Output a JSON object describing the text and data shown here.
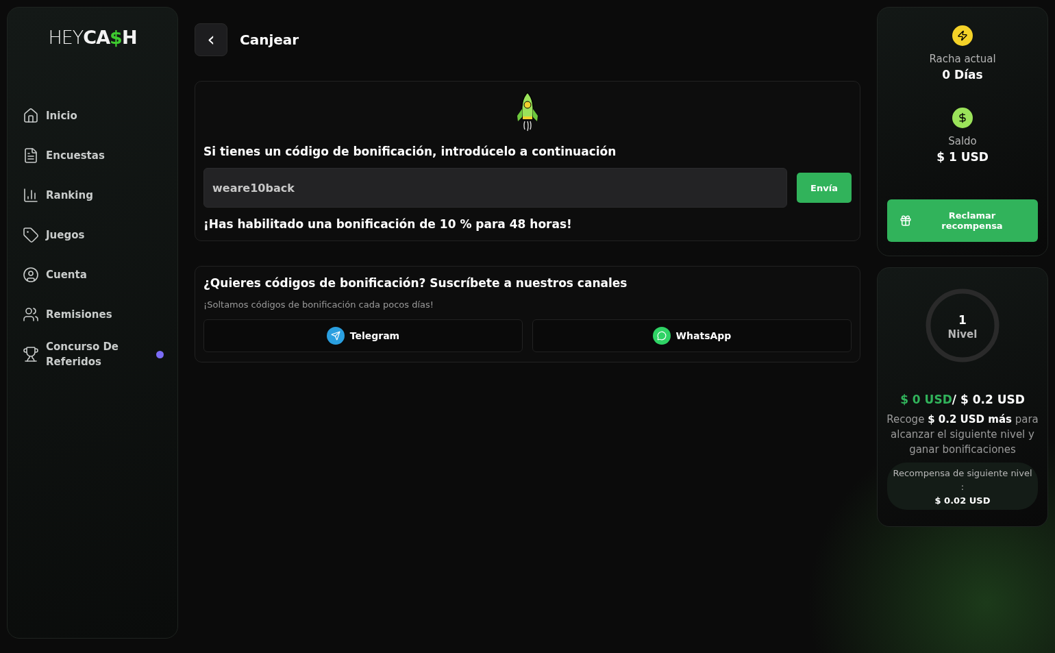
{
  "logo": [
    {
      "kind": "light",
      "text": "HEY"
    },
    {
      "kind": "bold",
      "text": "CA"
    },
    {
      "kind": "accent",
      "text": "$"
    },
    {
      "kind": "bold",
      "text": "H"
    }
  ],
  "nav": [
    {
      "label": "Inicio",
      "selected": false
    },
    {
      "label": "Encuestas",
      "selected": false
    },
    {
      "label": "Ranking",
      "selected": false
    },
    {
      "label": "Juegos",
      "selected": false
    },
    {
      "label": "Cuenta",
      "selected": false
    },
    {
      "label": "Remisiones",
      "selected": false
    },
    {
      "label": "Concurso De Referidos",
      "selected": false,
      "color": "#7b6cf6"
    }
  ],
  "header": {
    "back": "‹",
    "title": "Canjear"
  },
  "redeem": {
    "prompt": "Si tienes un código de bonificación, introdúcelo a continuación",
    "code_field": {
      "value": "weare10back"
    },
    "submit": "Envía",
    "message": "¡Has habilitado una bonificación de 10 % para 48 horas!"
  },
  "channels": {
    "title": "¿Quieres códigos de bonificación? Suscríbete a nuestros canales",
    "subtitle": "¡Soltamos códigos de bonificación cada pocos días!",
    "buttons": [
      {
        "kind": "telegram",
        "label": "Telegram"
      },
      {
        "kind": "whatsapp",
        "label": "WhatsApp"
      }
    ]
  },
  "stats": {
    "streak": {
      "label": "Racha actual",
      "value": "0 Días"
    },
    "balance": {
      "label": "Saldo",
      "value": "$ 1 USD"
    },
    "claim": "Reclamar recompensa"
  },
  "level": {
    "number": "1",
    "label": "Nivel",
    "current": "$ 0 USD",
    "target": "/ $ 0.2 USD",
    "hint": "Recoge **$ 0.2 USD más** para alcanzar el siguiente nivel y ganar bonificaciones",
    "reward_label": "Recompensa de siguiente nivel :",
    "reward_value": "$ 0.02 USD"
  }
}
